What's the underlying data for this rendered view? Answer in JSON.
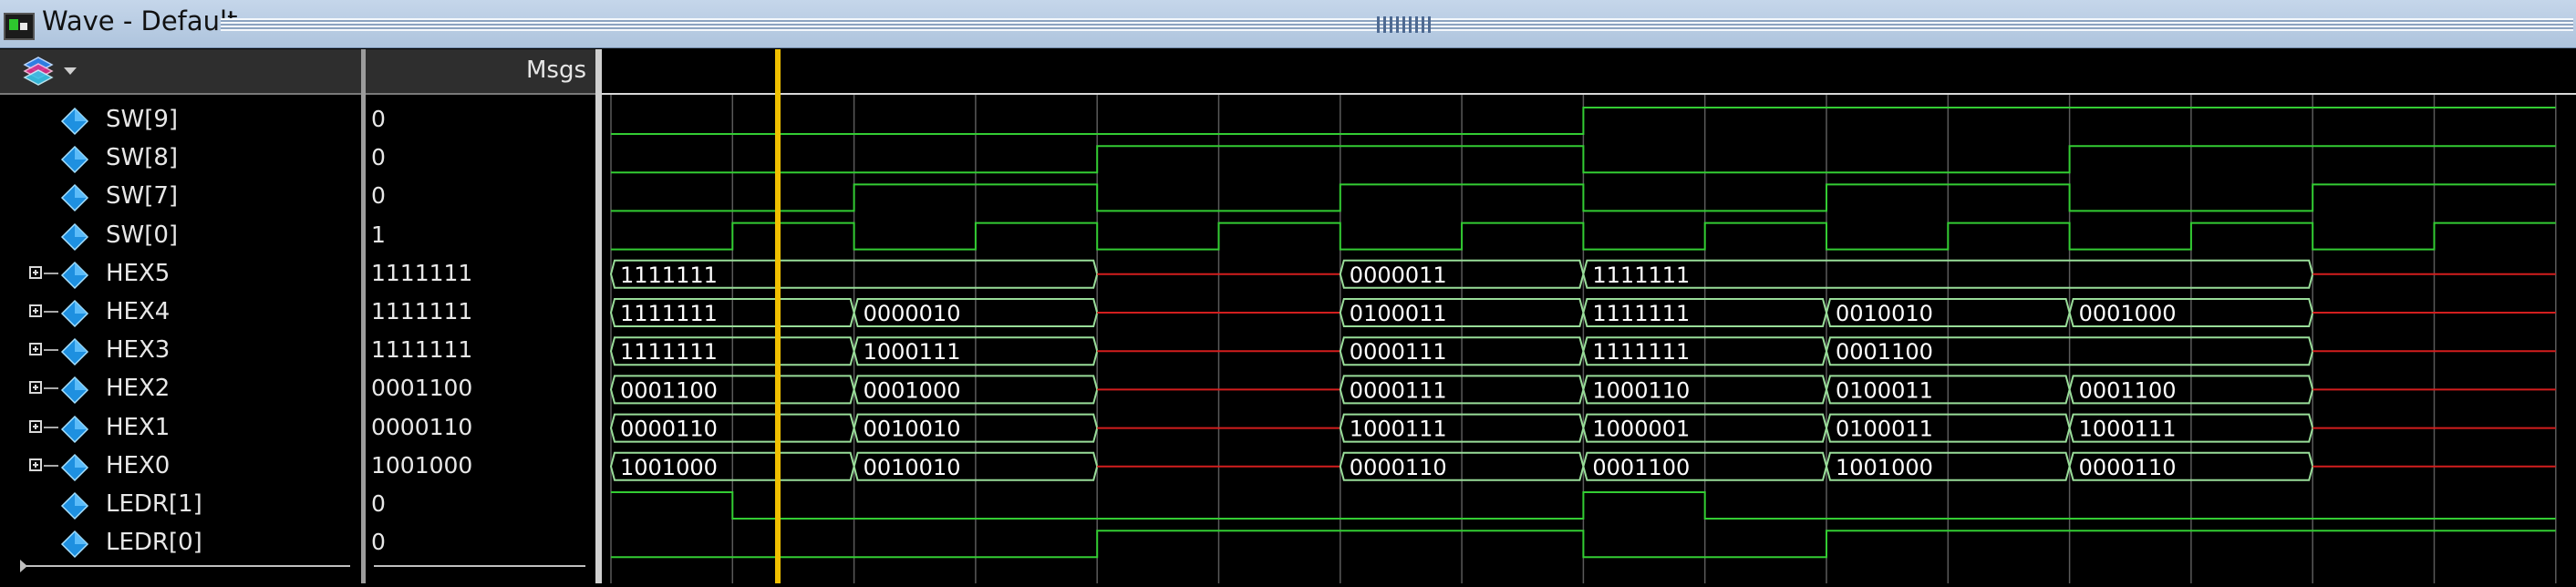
{
  "window": {
    "title": "Wave - Default"
  },
  "header": {
    "msgs_label": "Msgs"
  },
  "icons": {
    "title": "wave-window-icon",
    "layers": "layers-icon",
    "dropdown": "chevron-down-icon",
    "signal": "diamond-icon",
    "expand": "plus-icon"
  },
  "colors": {
    "digital_wave": "#33cc33",
    "bus_text": "#ffffff",
    "bus_outline": "#99dd99",
    "undefined": "#d21e1e",
    "cursor": "#f0c000"
  },
  "signals": [
    {
      "name": "SW[9]",
      "value": "0",
      "expandable": false
    },
    {
      "name": "SW[8]",
      "value": "0",
      "expandable": false
    },
    {
      "name": "SW[7]",
      "value": "0",
      "expandable": false
    },
    {
      "name": "SW[0]",
      "value": "1",
      "expandable": false
    },
    {
      "name": "HEX5",
      "value": "1111111",
      "expandable": true
    },
    {
      "name": "HEX4",
      "value": "1111111",
      "expandable": true
    },
    {
      "name": "HEX3",
      "value": "1111111",
      "expandable": true
    },
    {
      "name": "HEX2",
      "value": "0001100",
      "expandable": true
    },
    {
      "name": "HEX1",
      "value": "0000110",
      "expandable": true
    },
    {
      "name": "HEX0",
      "value": "1001000",
      "expandable": true
    },
    {
      "name": "LEDR[1]",
      "value": "0",
      "expandable": false
    },
    {
      "name": "LEDR[0]",
      "value": "0",
      "expandable": false
    }
  ],
  "waves": {
    "time_edges": [
      0,
      1,
      2,
      3,
      4,
      5,
      6,
      7,
      8,
      9,
      10,
      11,
      12,
      13,
      14,
      15,
      16
    ],
    "digital": [
      {
        "signal": "SW[9]",
        "levels": [
          0,
          0,
          0,
          0,
          0,
          0,
          0,
          0,
          1,
          1,
          1,
          1,
          1,
          1,
          1,
          1
        ]
      },
      {
        "signal": "SW[8]",
        "levels": [
          0,
          0,
          0,
          0,
          1,
          1,
          1,
          1,
          0,
          0,
          0,
          0,
          1,
          1,
          1,
          1
        ]
      },
      {
        "signal": "SW[7]",
        "levels": [
          0,
          0,
          1,
          1,
          0,
          0,
          1,
          1,
          0,
          0,
          1,
          1,
          0,
          0,
          1,
          1
        ]
      },
      {
        "signal": "SW[0]",
        "levels": [
          0,
          1,
          0,
          1,
          0,
          1,
          0,
          1,
          0,
          1,
          0,
          1,
          0,
          1,
          0,
          1
        ]
      },
      {
        "signal": "LEDR[1]",
        "levels": [
          1,
          0,
          0,
          0,
          0,
          0,
          0,
          0,
          1,
          0,
          0,
          0,
          0,
          0,
          0,
          0
        ]
      },
      {
        "signal": "LEDR[0]",
        "levels": [
          0,
          0,
          0,
          0,
          1,
          1,
          1,
          1,
          0,
          0,
          1,
          1,
          1,
          1,
          1,
          1
        ]
      }
    ],
    "buses": [
      {
        "signal": "HEX5",
        "segments": [
          {
            "start": 0,
            "end": 4,
            "label": "1111111"
          },
          {
            "start": 4,
            "end": 6,
            "label": ""
          },
          {
            "start": 6,
            "end": 8,
            "label": "0000011"
          },
          {
            "start": 8,
            "end": 14,
            "label": "1111111"
          },
          {
            "start": 14,
            "end": 16,
            "label": ""
          }
        ]
      },
      {
        "signal": "HEX4",
        "segments": [
          {
            "start": 0,
            "end": 2,
            "label": "1111111"
          },
          {
            "start": 2,
            "end": 4,
            "label": "0000010"
          },
          {
            "start": 4,
            "end": 6,
            "label": ""
          },
          {
            "start": 6,
            "end": 8,
            "label": "0100011"
          },
          {
            "start": 8,
            "end": 10,
            "label": "1111111"
          },
          {
            "start": 10,
            "end": 12,
            "label": "0010010"
          },
          {
            "start": 12,
            "end": 14,
            "label": "0001000"
          },
          {
            "start": 14,
            "end": 16,
            "label": ""
          }
        ]
      },
      {
        "signal": "HEX3",
        "segments": [
          {
            "start": 0,
            "end": 2,
            "label": "1111111"
          },
          {
            "start": 2,
            "end": 4,
            "label": "1000111"
          },
          {
            "start": 4,
            "end": 6,
            "label": ""
          },
          {
            "start": 6,
            "end": 8,
            "label": "0000111"
          },
          {
            "start": 8,
            "end": 10,
            "label": "1111111"
          },
          {
            "start": 10,
            "end": 14,
            "label": "0001100"
          },
          {
            "start": 14,
            "end": 16,
            "label": ""
          }
        ]
      },
      {
        "signal": "HEX2",
        "segments": [
          {
            "start": 0,
            "end": 2,
            "label": "0001100"
          },
          {
            "start": 2,
            "end": 4,
            "label": "0001000"
          },
          {
            "start": 4,
            "end": 6,
            "label": ""
          },
          {
            "start": 6,
            "end": 8,
            "label": "0000111"
          },
          {
            "start": 8,
            "end": 10,
            "label": "1000110"
          },
          {
            "start": 10,
            "end": 12,
            "label": "0100011"
          },
          {
            "start": 12,
            "end": 14,
            "label": "0001100"
          },
          {
            "start": 14,
            "end": 16,
            "label": ""
          }
        ]
      },
      {
        "signal": "HEX1",
        "segments": [
          {
            "start": 0,
            "end": 2,
            "label": "0000110"
          },
          {
            "start": 2,
            "end": 4,
            "label": "0010010"
          },
          {
            "start": 4,
            "end": 6,
            "label": ""
          },
          {
            "start": 6,
            "end": 8,
            "label": "1000111"
          },
          {
            "start": 8,
            "end": 10,
            "label": "1000001"
          },
          {
            "start": 10,
            "end": 12,
            "label": "0100011"
          },
          {
            "start": 12,
            "end": 14,
            "label": "1000111"
          },
          {
            "start": 14,
            "end": 16,
            "label": ""
          }
        ]
      },
      {
        "signal": "HEX0",
        "segments": [
          {
            "start": 0,
            "end": 2,
            "label": "1001000"
          },
          {
            "start": 2,
            "end": 4,
            "label": "0010010"
          },
          {
            "start": 4,
            "end": 6,
            "label": ""
          },
          {
            "start": 6,
            "end": 8,
            "label": "0000110"
          },
          {
            "start": 8,
            "end": 10,
            "label": "0001100"
          },
          {
            "start": 10,
            "end": 12,
            "label": "1001000"
          },
          {
            "start": 12,
            "end": 14,
            "label": "0000110"
          },
          {
            "start": 14,
            "end": 16,
            "label": ""
          }
        ]
      }
    ],
    "cursor_time": 1.4
  }
}
